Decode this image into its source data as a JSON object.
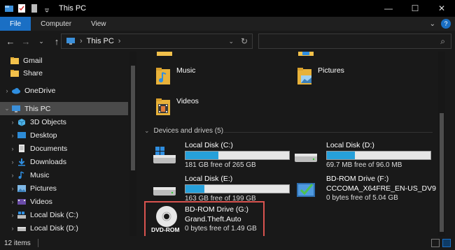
{
  "window": {
    "title": "This PC",
    "minimize": "—",
    "maximize": "☐",
    "close": "✕"
  },
  "ribbon": {
    "tabs": [
      "File",
      "Computer",
      "View"
    ],
    "expand": "⌄",
    "help": "?"
  },
  "nav": {
    "back": "←",
    "forward": "→",
    "recent": "⌄",
    "up": "↑",
    "address": "This PC",
    "address_chevron": "›",
    "dropdown": "⌄",
    "refresh": "↻",
    "search_placeholder": "",
    "search_icon": "⌕"
  },
  "sidebar": {
    "items": [
      {
        "label": "Gmail",
        "arrow": "",
        "icon": "folder-icon"
      },
      {
        "label": "Share",
        "arrow": "",
        "icon": "folder-icon"
      },
      {
        "label": "OneDrive",
        "arrow": "›",
        "icon": "cloud-icon"
      },
      {
        "label": "This PC",
        "arrow": "⌄",
        "icon": "monitor-icon"
      },
      {
        "label": "3D Objects",
        "arrow": "›",
        "icon": "cube-icon"
      },
      {
        "label": "Desktop",
        "arrow": "›",
        "icon": "desktop-icon"
      },
      {
        "label": "Documents",
        "arrow": "›",
        "icon": "documents-icon"
      },
      {
        "label": "Downloads",
        "arrow": "›",
        "icon": "download-icon"
      },
      {
        "label": "Music",
        "arrow": "›",
        "icon": "music-icon"
      },
      {
        "label": "Pictures",
        "arrow": "›",
        "icon": "pictures-icon"
      },
      {
        "label": "Videos",
        "arrow": "›",
        "icon": "videos-icon"
      },
      {
        "label": "Local Disk (C:)",
        "arrow": "›",
        "icon": "windows-drive-icon"
      },
      {
        "label": "Local Disk (D:)",
        "arrow": "›",
        "icon": "drive-icon"
      }
    ]
  },
  "folders": [
    {
      "label": "Music",
      "icon": "music-folder-icon"
    },
    {
      "label": "Pictures",
      "icon": "pictures-folder-icon"
    },
    {
      "label": "Videos",
      "icon": "videos-folder-icon"
    }
  ],
  "devices": {
    "header": "Devices and drives (5)",
    "chevron": "⌄",
    "drives": [
      {
        "name": "Local Disk (C:)",
        "free": "181 GB free of 265 GB",
        "used_fraction": 0.32,
        "icon": "windows-drive-icon"
      },
      {
        "name": "Local Disk (D:)",
        "free": "69.7 MB free of 96.0 MB",
        "used_fraction": 0.27,
        "icon": "drive-icon"
      },
      {
        "name": "Local Disk (E:)",
        "free": "163 GB free of 199 GB",
        "used_fraction": 0.18,
        "icon": "drive-icon"
      },
      {
        "name": "BD-ROM Drive (F:)",
        "sub": "CCCOMA_X64FRE_EN-US_DV9",
        "free": "0 bytes free of 5.04 GB",
        "icon": "disc-install-icon"
      },
      {
        "name": "BD-ROM Drive (G:)",
        "sub": "Grand.Theft.Auto",
        "free": "0 bytes free of 1.49 GB",
        "icon": "dvd-rom-icon",
        "icon_text": "DVD-ROM"
      }
    ]
  },
  "status": {
    "count": "12 items"
  },
  "colors": {
    "accent": "#1a6fc4",
    "bar_fill": "#26a0da",
    "highlight": "#d9534f"
  }
}
